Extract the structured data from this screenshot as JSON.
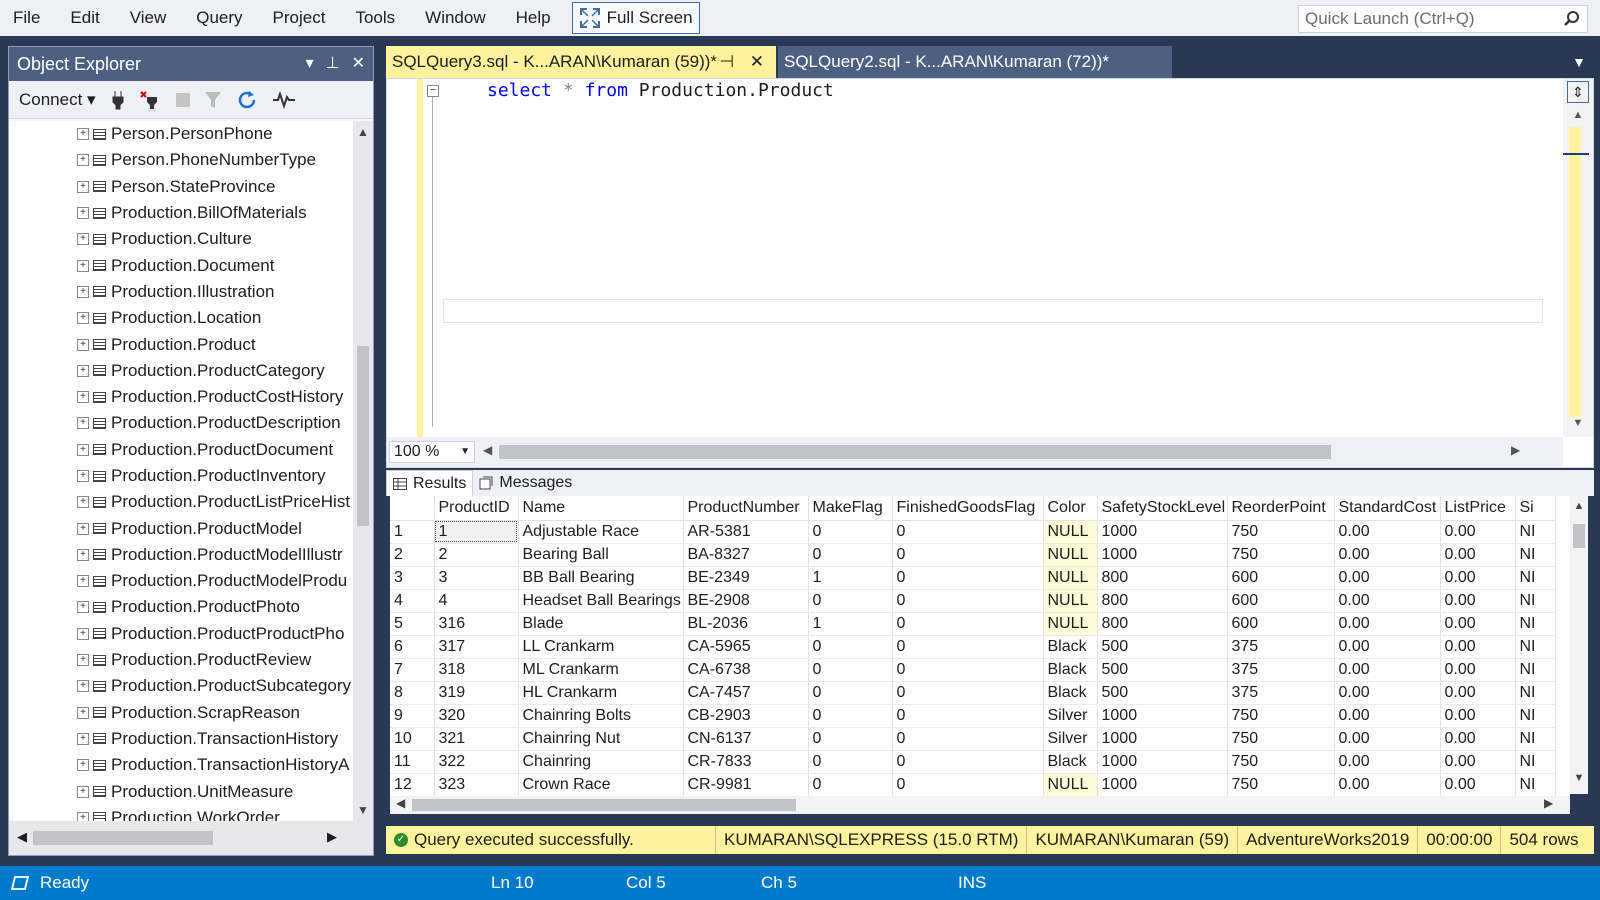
{
  "menu": [
    "File",
    "Edit",
    "View",
    "Query",
    "Project",
    "Tools",
    "Window",
    "Help"
  ],
  "full_screen_label": "Full Screen",
  "quick_launch_placeholder": "Quick Launch (Ctrl+Q)",
  "object_explorer": {
    "title": "Object Explorer",
    "connect_label": "Connect",
    "tree_items": [
      "Person.PersonPhone",
      "Person.PhoneNumberType",
      "Person.StateProvince",
      "Production.BillOfMaterials",
      "Production.Culture",
      "Production.Document",
      "Production.Illustration",
      "Production.Location",
      "Production.Product",
      "Production.ProductCategory",
      "Production.ProductCostHistory",
      "Production.ProductDescription",
      "Production.ProductDocument",
      "Production.ProductInventory",
      "Production.ProductListPriceHist",
      "Production.ProductModel",
      "Production.ProductModelIllustr",
      "Production.ProductModelProdu",
      "Production.ProductPhoto",
      "Production.ProductProductPho",
      "Production.ProductReview",
      "Production.ProductSubcategory",
      "Production.ScrapReason",
      "Production.TransactionHistory",
      "Production.TransactionHistoryA",
      "Production.UnitMeasure",
      "Production.WorkOrder"
    ]
  },
  "tabs": [
    {
      "label": "SQLQuery3.sql - K...ARAN\\Kumaran (59))*"
    },
    {
      "label": "SQLQuery2.sql - K...ARAN\\Kumaran (72))*"
    }
  ],
  "editor": {
    "keyword_select": "select",
    "star": "*",
    "keyword_from": "from",
    "object_name": "Production.Product",
    "zoom": "100 %"
  },
  "results_tabs": {
    "results": "Results",
    "messages": "Messages"
  },
  "grid": {
    "columns": [
      "ProductID",
      "Name",
      "ProductNumber",
      "MakeFlag",
      "FinishedGoodsFlag",
      "Color",
      "SafetyStockLevel",
      "ReorderPoint",
      "StandardCost",
      "ListPrice",
      "Si"
    ],
    "rows": [
      [
        "1",
        "1",
        "Adjustable Race",
        "AR-5381",
        "0",
        "0",
        "NULL",
        "1000",
        "750",
        "0.00",
        "0.00",
        "NI"
      ],
      [
        "2",
        "2",
        "Bearing Ball",
        "BA-8327",
        "0",
        "0",
        "NULL",
        "1000",
        "750",
        "0.00",
        "0.00",
        "NI"
      ],
      [
        "3",
        "3",
        "BB Ball Bearing",
        "BE-2349",
        "1",
        "0",
        "NULL",
        "800",
        "600",
        "0.00",
        "0.00",
        "NI"
      ],
      [
        "4",
        "4",
        "Headset Ball Bearings",
        "BE-2908",
        "0",
        "0",
        "NULL",
        "800",
        "600",
        "0.00",
        "0.00",
        "NI"
      ],
      [
        "5",
        "316",
        "Blade",
        "BL-2036",
        "1",
        "0",
        "NULL",
        "800",
        "600",
        "0.00",
        "0.00",
        "NI"
      ],
      [
        "6",
        "317",
        "LL Crankarm",
        "CA-5965",
        "0",
        "0",
        "Black",
        "500",
        "375",
        "0.00",
        "0.00",
        "NI"
      ],
      [
        "7",
        "318",
        "ML Crankarm",
        "CA-6738",
        "0",
        "0",
        "Black",
        "500",
        "375",
        "0.00",
        "0.00",
        "NI"
      ],
      [
        "8",
        "319",
        "HL Crankarm",
        "CA-7457",
        "0",
        "0",
        "Black",
        "500",
        "375",
        "0.00",
        "0.00",
        "NI"
      ],
      [
        "9",
        "320",
        "Chainring Bolts",
        "CB-2903",
        "0",
        "0",
        "Silver",
        "1000",
        "750",
        "0.00",
        "0.00",
        "NI"
      ],
      [
        "10",
        "321",
        "Chainring Nut",
        "CN-6137",
        "0",
        "0",
        "Silver",
        "1000",
        "750",
        "0.00",
        "0.00",
        "NI"
      ],
      [
        "11",
        "322",
        "Chainring",
        "CR-7833",
        "0",
        "0",
        "Black",
        "1000",
        "750",
        "0.00",
        "0.00",
        "NI"
      ],
      [
        "12",
        "323",
        "Crown Race",
        "CR-9981",
        "0",
        "0",
        "NULL",
        "1000",
        "750",
        "0.00",
        "0.00",
        "NI"
      ]
    ]
  },
  "query_status": {
    "message": "Query executed successfully.",
    "server": "KUMARAN\\SQLEXPRESS (15.0 RTM)",
    "user": "KUMARAN\\Kumaran (59)",
    "database": "AdventureWorks2019",
    "elapsed": "00:00:00",
    "rows": "504 rows"
  },
  "status_bar": {
    "state": "Ready",
    "line": "Ln 10",
    "col": "Col 5",
    "ch": "Ch 5",
    "mode": "INS"
  },
  "colors": {
    "accent_blue": "#007acc",
    "chrome_dark": "#293955",
    "active_tab_yellow": "#fff29d",
    "keyword_blue": "#0000ff"
  },
  "icons": [
    "full-screen-icon",
    "search-icon",
    "pin-icon",
    "close-icon",
    "connect-icon",
    "disconnect-icon",
    "stop-icon",
    "filter-icon",
    "refresh-icon",
    "activity-monitor-icon",
    "table-icon",
    "grid-icon",
    "messages-icon",
    "success-icon",
    "ready-icon"
  ]
}
